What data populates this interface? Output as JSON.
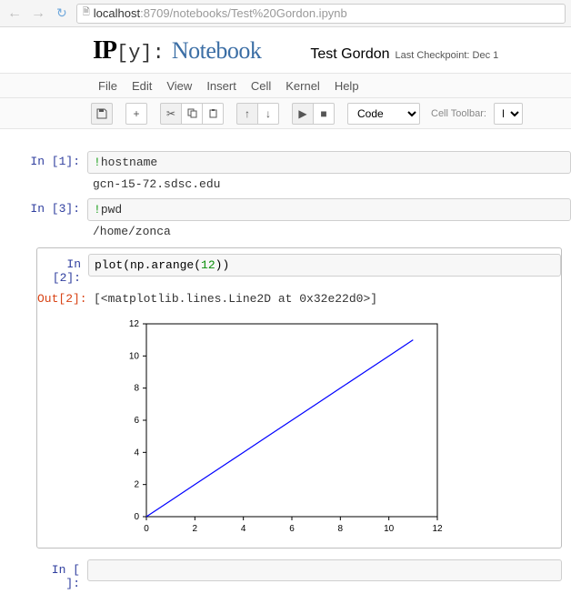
{
  "browser": {
    "url_host": "localhost",
    "url_path": ":8709/notebooks/Test%20Gordon.ipynb"
  },
  "header": {
    "logo_ip": "IP",
    "logo_y": "[y]:",
    "logo_notebook": "Notebook",
    "title": "Test Gordon",
    "checkpoint": "Last Checkpoint: Dec 1"
  },
  "menu": {
    "items": [
      "File",
      "Edit",
      "View",
      "Insert",
      "Cell",
      "Kernel",
      "Help"
    ]
  },
  "toolbar": {
    "cell_type_selected": "Code",
    "cell_toolbar_label": "Cell Toolbar:",
    "cell_toolbar_selected": "Non"
  },
  "cells": [
    {
      "in_prompt": "In [1]:",
      "code_bang": "!",
      "code_cmd": "hostname",
      "output": "gcn-15-72.sdsc.edu"
    },
    {
      "in_prompt": "In [3]:",
      "code_bang": "!",
      "code_cmd": "pwd",
      "output": "/home/zonca"
    },
    {
      "in_prompt": "In [2]:",
      "code_text": "plot(np.arange(",
      "code_num": "12",
      "code_tail": "))",
      "out_prompt": "Out[2]:",
      "out_text": "[<matplotlib.lines.Line2D at 0x32e22d0>]"
    },
    {
      "in_prompt": "In [ ]:"
    }
  ],
  "chart_data": {
    "type": "line",
    "x": [
      0,
      1,
      2,
      3,
      4,
      5,
      6,
      7,
      8,
      9,
      10,
      11
    ],
    "y": [
      0,
      1,
      2,
      3,
      4,
      5,
      6,
      7,
      8,
      9,
      10,
      11
    ],
    "xlim": [
      0,
      12
    ],
    "ylim": [
      0,
      12
    ],
    "xticks": [
      0,
      2,
      4,
      6,
      8,
      10,
      12
    ],
    "yticks": [
      0,
      2,
      4,
      6,
      8,
      10,
      12
    ],
    "xlabel": "",
    "ylabel": "",
    "title": "",
    "line_color": "#0000ff"
  }
}
